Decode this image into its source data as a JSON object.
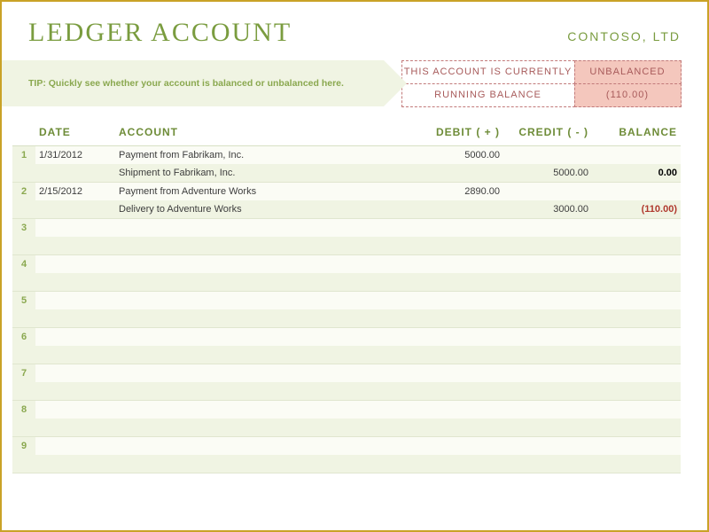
{
  "header": {
    "title": "LEDGER ACCOUNT",
    "company": "CONTOSO, LTD"
  },
  "tip": "TIP: Quickly see whether your account is balanced or unbalanced here.",
  "status": {
    "label1": "THIS ACCOUNT IS CURRENTLY",
    "value1": "UNBALANCED",
    "label2": "RUNNING BALANCE",
    "value2": "(110.00)"
  },
  "columns": {
    "date": "DATE",
    "account": "ACCOUNT",
    "debit": "DEBIT ( + )",
    "credit": "CREDIT ( - )",
    "balance": "BALANCE"
  },
  "entries": [
    {
      "num": "1",
      "date": "1/31/2012",
      "lines": [
        {
          "account": "Payment from Fabrikam, Inc.",
          "debit": "5000.00",
          "credit": "",
          "balance": "",
          "balClass": ""
        },
        {
          "account": "Shipment to Fabrikam, Inc.",
          "debit": "",
          "credit": "5000.00",
          "balance": "0.00",
          "balClass": "bold"
        }
      ]
    },
    {
      "num": "2",
      "date": "2/15/2012",
      "lines": [
        {
          "account": "Payment from Adventure Works",
          "debit": "2890.00",
          "credit": "",
          "balance": "",
          "balClass": ""
        },
        {
          "account": "Delivery to Adventure Works",
          "debit": "",
          "credit": "3000.00",
          "balance": "(110.00)",
          "balClass": "neg"
        }
      ]
    }
  ],
  "emptyGroups": [
    "3",
    "4",
    "5",
    "6",
    "7",
    "8",
    "9"
  ]
}
